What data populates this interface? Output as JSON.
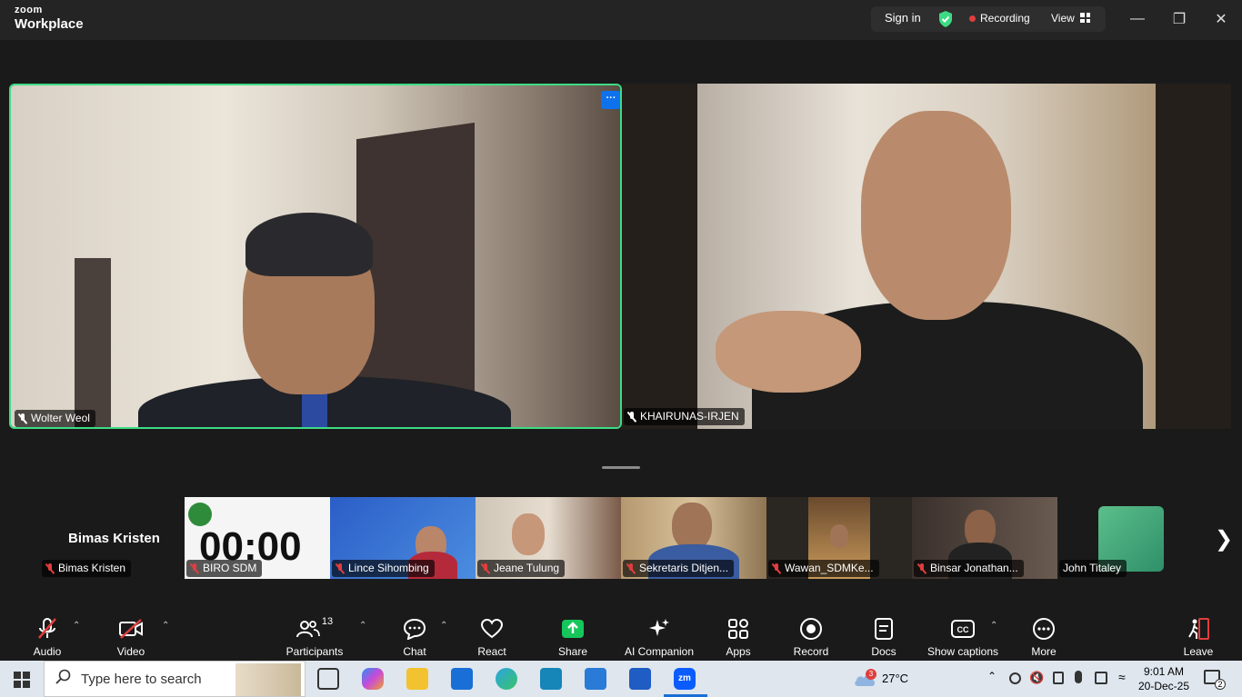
{
  "titlebar": {
    "logo_top": "zoom",
    "logo_bottom": "Workplace",
    "sign_in": "Sign in",
    "recording": "Recording",
    "view": "View",
    "recording_color": "#e03e3e",
    "shield_color": "#3ddc84"
  },
  "main_videos": [
    {
      "name": "Wolter Weol",
      "active_speaker": true,
      "muted": false
    },
    {
      "name": "KHAIRUNAS-IRJEN",
      "active_speaker": false,
      "muted": false
    }
  ],
  "more_button": "···",
  "filmstrip": {
    "title": "Bimas Kristen",
    "participants": [
      {
        "name": "Bimas Kristen",
        "muted": true
      },
      {
        "name": "BIRO SDM",
        "muted": true,
        "content_timer": "00:00"
      },
      {
        "name": "Lince Sihombing",
        "muted": true
      },
      {
        "name": "Jeane Tulung",
        "muted": true
      },
      {
        "name": "Sekretaris Ditjen...",
        "muted": true
      },
      {
        "name": "Wawan_SDMKe...",
        "muted": true
      },
      {
        "name": "Binsar Jonathan...",
        "muted": true
      },
      {
        "name": "John Titaley",
        "muted": false
      }
    ]
  },
  "toolbar": {
    "audio": "Audio",
    "video": "Video",
    "participants": "Participants",
    "participants_count": "13",
    "chat": "Chat",
    "react": "React",
    "share": "Share",
    "ai_companion": "AI Companion",
    "apps": "Apps",
    "record": "Record",
    "docs": "Docs",
    "captions": "Show captions",
    "more": "More",
    "leave": "Leave",
    "share_color": "#16c65a",
    "leave_color": "#e03e3e"
  },
  "taskbar": {
    "search_placeholder": "Type here to search",
    "weather_temp": "27°C",
    "weather_badge": "3",
    "time": "9:01 AM",
    "date": "20-Dec-25",
    "notification_count": "2"
  }
}
